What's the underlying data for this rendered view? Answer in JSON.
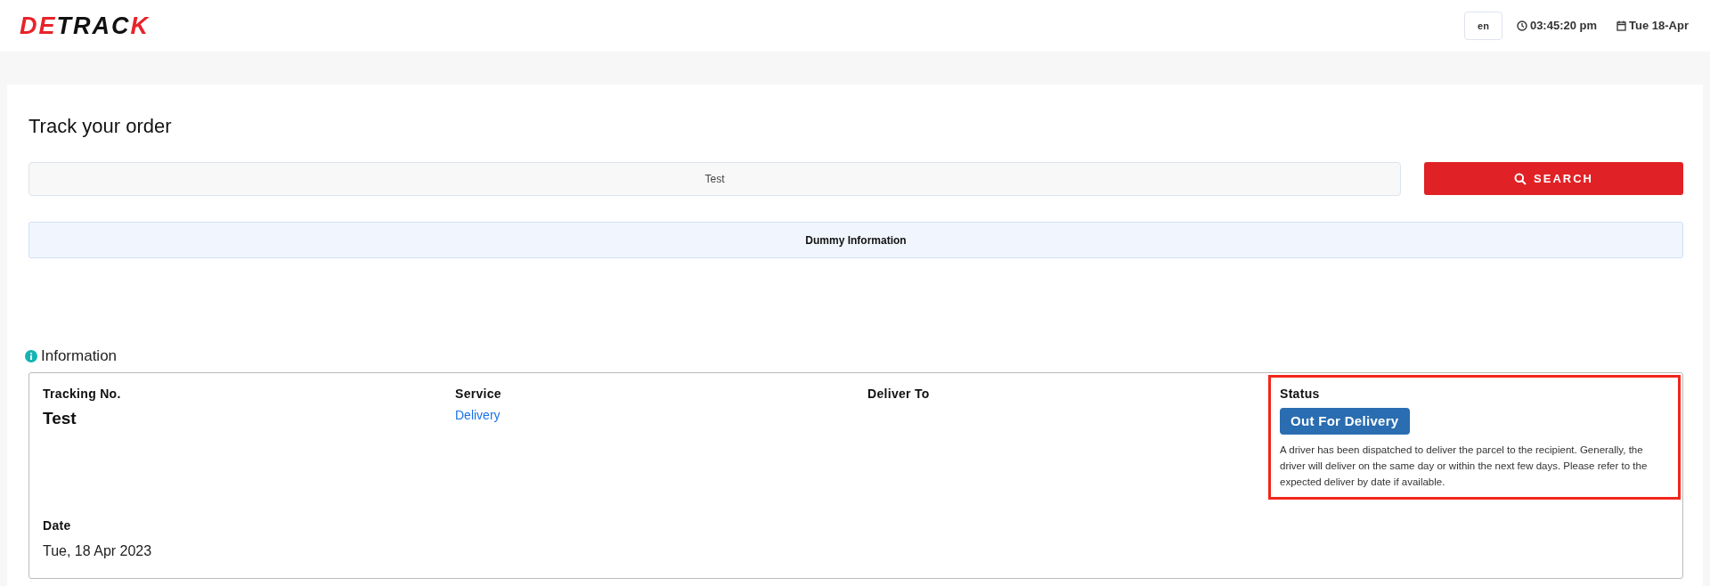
{
  "header": {
    "logo": [
      {
        "text": "DE",
        "color": "#e8232a"
      },
      {
        "text": "TRAC",
        "color": "#111111"
      },
      {
        "text": "K",
        "color": "#e8232a"
      }
    ],
    "language": "en",
    "time": "03:45:20 pm",
    "date": "Tue 18-Apr"
  },
  "page": {
    "title": "Track your order",
    "search": {
      "value": "Test",
      "button": "SEARCH"
    },
    "notice": "Dummy Information"
  },
  "information": {
    "title": "Information",
    "fields": [
      {
        "label": "Tracking No.",
        "kind": "large",
        "value": "Test",
        "highlighted": false
      },
      {
        "label": "Service",
        "kind": "link",
        "value": "Delivery",
        "highlighted": false
      },
      {
        "label": "Deliver To",
        "kind": "empty",
        "highlighted": false
      },
      {
        "label": "Status",
        "kind": "badge",
        "value": "Out For Delivery",
        "description": "A driver has been dispatched to deliver the parcel to the recipient. Generally, the driver will deliver on the same day or within the next few days. Please refer to the expected deliver by date if available.",
        "highlighted": true
      },
      {
        "label": "Date",
        "kind": "plain",
        "value": "Tue, 18 Apr 2023",
        "highlighted": false
      }
    ]
  }
}
